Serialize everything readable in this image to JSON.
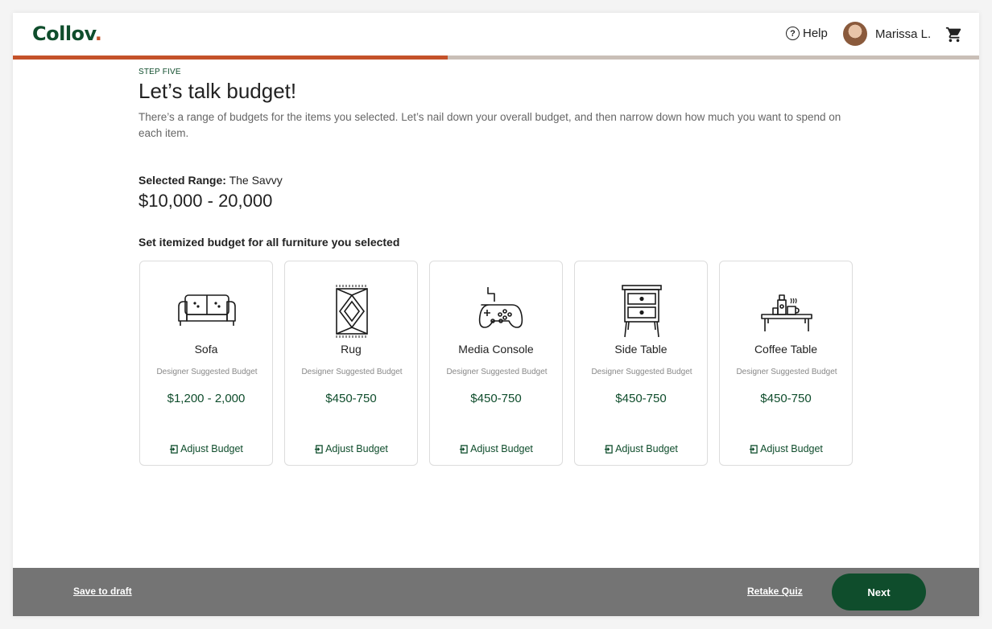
{
  "header": {
    "logo_text": "Collov",
    "logo_dot": ".",
    "help_label": "Help",
    "user_name": "Marissa L."
  },
  "progress": {
    "fraction": 0.45
  },
  "main": {
    "step_label": "STEP FIVE",
    "title": "Let’s talk budget!",
    "description": "There’s a range of budgets for the items you selected. Let’s nail down your overall budget, and then narrow down how much you want to spend on each item.",
    "selected_range_label": "Selected Range:",
    "selected_range_name": "The Savvy",
    "selected_range_value": "$10,000 - 20,000",
    "itemized_label": "Set itemized budget for all furniture you selected"
  },
  "cards": [
    {
      "icon": "sofa-icon",
      "name": "Sofa",
      "sub": "Designer Suggested Budget",
      "price": "$1,200 - 2,000",
      "adjust": "Adjust Budget"
    },
    {
      "icon": "rug-icon",
      "name": "Rug",
      "sub": "Designer Suggested Budget",
      "price": "$450-750",
      "adjust": "Adjust Budget"
    },
    {
      "icon": "game-controller-icon",
      "name": "Media Console",
      "sub": "Designer Suggested Budget",
      "price": "$450-750",
      "adjust": "Adjust Budget"
    },
    {
      "icon": "side-table-icon",
      "name": "Side Table",
      "sub": "Designer Suggested Budget",
      "price": "$450-750",
      "adjust": "Adjust Budget"
    },
    {
      "icon": "coffee-table-icon",
      "name": "Coffee Table",
      "sub": "Designer Suggested Budget",
      "price": "$450-750",
      "adjust": "Adjust Budget"
    }
  ],
  "footer": {
    "save_draft": "Save to draft",
    "retake_quiz": "Retake Quiz",
    "next": "Next"
  },
  "colors": {
    "brand_green": "#0f4d2c",
    "accent_orange": "#c4522a",
    "footer_gray": "#747474"
  }
}
